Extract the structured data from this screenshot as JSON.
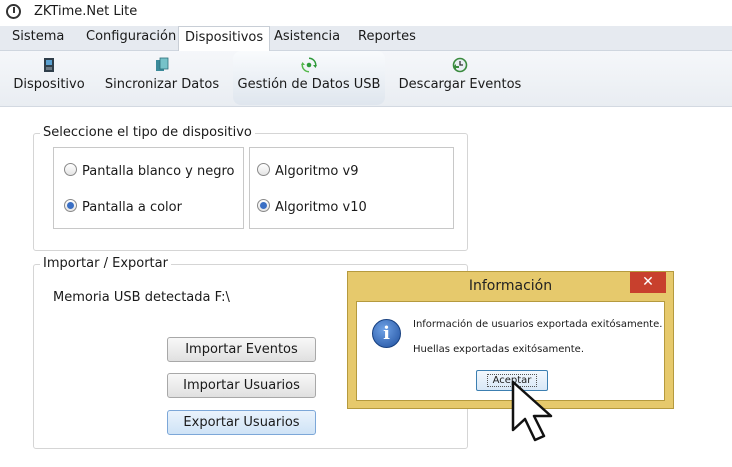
{
  "window": {
    "title": "ZKTime.Net Lite"
  },
  "menu": [
    "Sistema",
    "Configuración",
    "Dispositivos",
    "Asistencia",
    "Reportes"
  ],
  "toolbar": {
    "items": [
      {
        "label": "Dispositivo",
        "icon": "device-icon"
      },
      {
        "label": "Sincronizar Datos",
        "icon": "sync-icon"
      },
      {
        "label": "Gestión de Datos USB",
        "icon": "usb-data-icon"
      },
      {
        "label": "Descargar Eventos",
        "icon": "download-events-icon"
      }
    ]
  },
  "device_type": {
    "legend": "Seleccione el tipo de dispositivo",
    "screen": {
      "blackwhite": "Pantalla blanco y negro",
      "color": "Pantalla a color",
      "selected": "Pantalla a color"
    },
    "algorithm": {
      "v9": "Algoritmo v9",
      "v10": "Algoritmo v10",
      "selected": "Algoritmo v10"
    }
  },
  "import_export": {
    "legend": "Importar / Exportar",
    "usb_status": "Memoria USB detectada F:\\",
    "import_events": "Importar Eventos",
    "import_users": "Importar Usuarios",
    "export_users": "Exportar Usuarios"
  },
  "dialog": {
    "title": "Información",
    "close": "✕",
    "icon_text": "i",
    "message1": "Información de usuarios exportada exitósamente.",
    "message2": "Huellas exportadas exitósamente.",
    "ok": "Aceptar"
  },
  "colors": {
    "dialog_frame": "#e6c96c",
    "close_button": "#c8402d",
    "radio_selected": "#3a6fc4"
  }
}
